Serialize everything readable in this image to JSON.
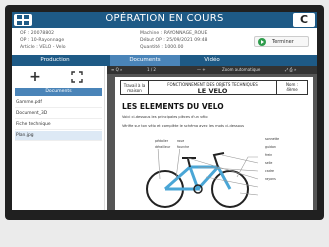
{
  "header": {
    "title": "OPÉRATION EN COURS",
    "refresh_icon": "C"
  },
  "info": {
    "left": [
      "OF : 20078802",
      "OP : 10-Rayonnage",
      "Article : VELO - Velo"
    ],
    "right": [
      "Machine : RAYONNAGE_ROUE",
      "Début OP : 25/09/2021 09:48",
      "Quantité : 1000.00"
    ]
  },
  "terminer_label": "Terminer",
  "tabs": [
    "Production",
    "Documents",
    "Vidéo"
  ],
  "left_panel": {
    "add_icon": "+",
    "header": "Documents",
    "docs": [
      "Gamme.pdf",
      "Document_3D",
      "Fiche technique",
      "Plan.jpg"
    ]
  },
  "document": {
    "toolbar": [
      "≡  Q  ⌕",
      "1 / 2",
      "—  +",
      "Zoom automatique",
      "⤢  ⎙  »"
    ],
    "header_left": "Travail à la maison",
    "header_mid_top": "FONCTIONNEMENT DES OBJETS TECHNIQUES",
    "header_mid_main": "LE VELO",
    "header_right_top": "Nom :",
    "header_right_bottom": "4ème",
    "title": "LES ELEMENTS DU VELO",
    "line1": "Voici ci-dessous les principales pièces d'un vélo",
    "line2": "Vérifie sur ton vélo et complète le schéma avec les mots ci-dessous",
    "labels_left": [
      "pédalier",
      "roue",
      "dérailleur",
      "fourche"
    ],
    "labels_right": [
      "sonnette",
      "guidon",
      "frein",
      "selle",
      "cadre",
      "rayons"
    ]
  }
}
